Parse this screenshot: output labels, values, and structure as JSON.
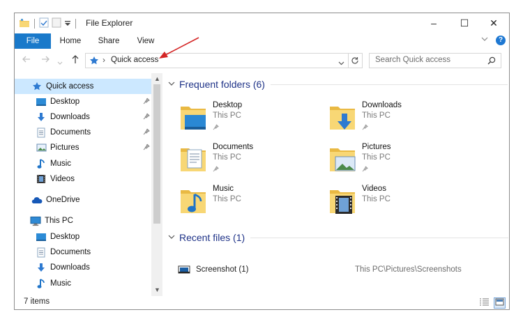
{
  "window": {
    "title": "File Explorer"
  },
  "window_controls": [
    "–",
    "☐",
    "✕"
  ],
  "ribbon": {
    "tabs": [
      "File",
      "Home",
      "Share",
      "View"
    ],
    "help": "?"
  },
  "address_bar": {
    "separator": "›",
    "location": "Quick access"
  },
  "search": {
    "placeholder": "Search Quick access"
  },
  "nav_pane": {
    "quick_access": "Quick access",
    "pinned": [
      {
        "label": "Desktop",
        "icon": "desktop-icon"
      },
      {
        "label": "Downloads",
        "icon": "downloads-icon"
      },
      {
        "label": "Documents",
        "icon": "documents-icon"
      },
      {
        "label": "Pictures",
        "icon": "pictures-icon"
      }
    ],
    "unpinned": [
      {
        "label": "Music",
        "icon": "music-icon"
      },
      {
        "label": "Videos",
        "icon": "videos-icon"
      }
    ],
    "onedrive": "OneDrive",
    "this_pc": "This PC",
    "this_pc_items": [
      "Desktop",
      "Documents",
      "Downloads",
      "Music"
    ]
  },
  "frequent_folders": {
    "heading": "Frequent folders (6)",
    "items": [
      {
        "name": "Desktop",
        "location": "This PC",
        "overlay": "desktop"
      },
      {
        "name": "Downloads",
        "location": "This PC",
        "overlay": "downloads"
      },
      {
        "name": "Documents",
        "location": "This PC",
        "overlay": "documents"
      },
      {
        "name": "Pictures",
        "location": "This PC",
        "overlay": "pictures"
      },
      {
        "name": "Music",
        "location": "This PC",
        "overlay": "music"
      },
      {
        "name": "Videos",
        "location": "This PC",
        "overlay": "videos"
      }
    ]
  },
  "recent_files": {
    "heading": "Recent files (1)",
    "items": [
      {
        "name": "Screenshot (1)",
        "path": "This PC\\Pictures\\Screenshots"
      }
    ]
  },
  "status_bar": {
    "count": "7 items"
  },
  "colors": {
    "accent": "#1979ca",
    "selected": "#cce8ff",
    "group_heading": "#1e3287",
    "folder": "#f8d775",
    "annotation_arrow": "#d42525"
  }
}
